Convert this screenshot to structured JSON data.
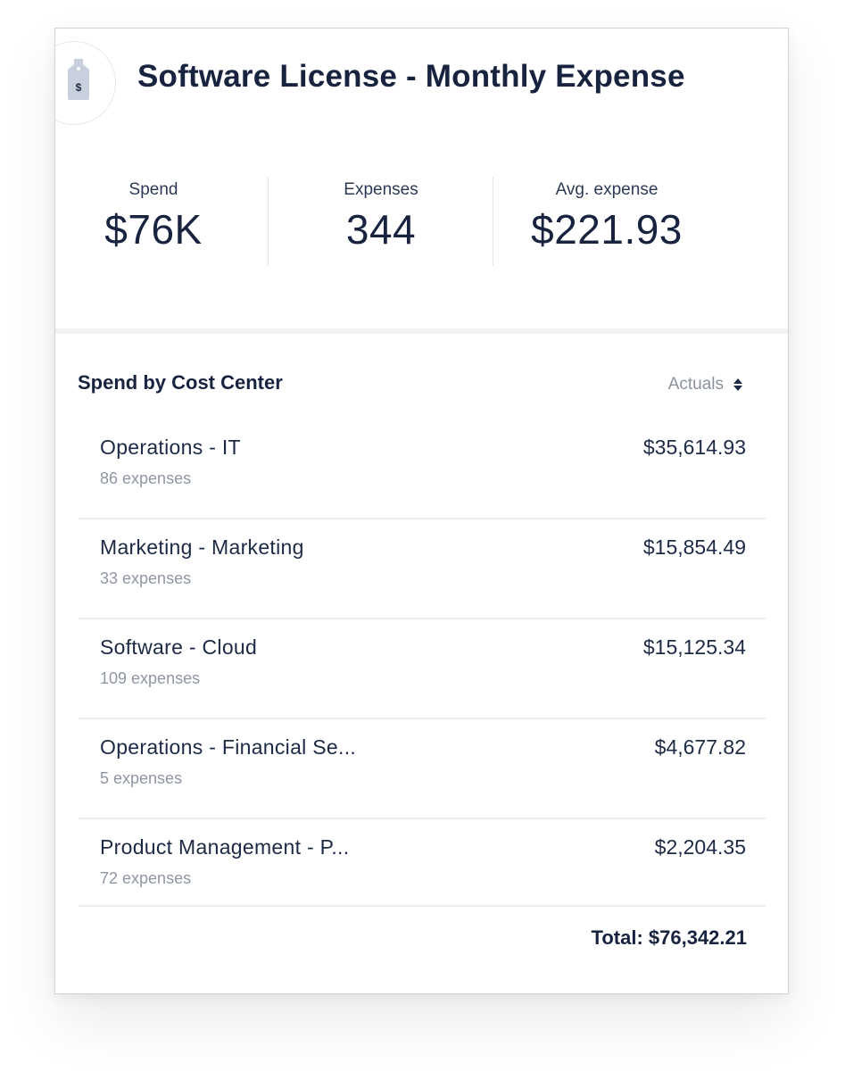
{
  "header": {
    "title": "Software License - Monthly Expense",
    "icon": "price-tag-icon",
    "icon_glyph": "$"
  },
  "stats": [
    {
      "label": "Spend",
      "value": "$76K"
    },
    {
      "label": "Expenses",
      "value": "344"
    },
    {
      "label": "Avg. expense",
      "value": "$221.93"
    }
  ],
  "section": {
    "title": "Spend by Cost Center",
    "sort_label": "Actuals",
    "sort_icon": "sort-arrows-icon"
  },
  "rows": [
    {
      "name": "Operations - IT",
      "count": "86 expenses",
      "amount": "$35,614.93"
    },
    {
      "name": "Marketing - Marketing",
      "count": "33 expenses",
      "amount": "$15,854.49"
    },
    {
      "name": "Software - Cloud",
      "count": "109 expenses",
      "amount": "$15,125.34"
    },
    {
      "name": "Operations - Financial Se...",
      "count": "5 expenses",
      "amount": "$4,677.82"
    },
    {
      "name": "Product Management - P...",
      "count": "72 expenses",
      "amount": "$2,204.35"
    }
  ],
  "total": "Total: $76,342.21",
  "colors": {
    "text_primary": "#17233f",
    "text_muted": "#8f96a3",
    "icon_fill": "#c9d0dd",
    "divider": "#eceef1"
  }
}
